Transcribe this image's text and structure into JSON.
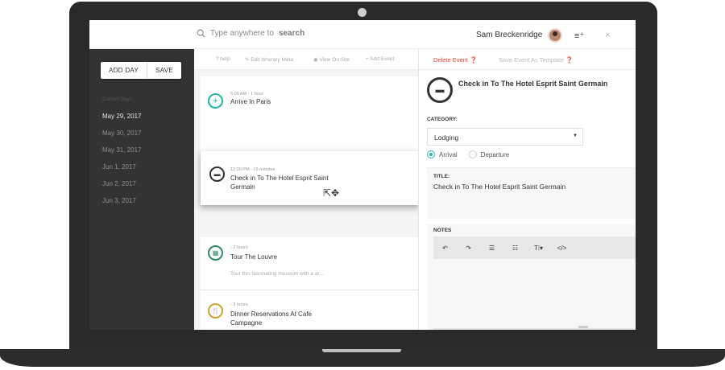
{
  "search": {
    "placeholder_prefix": "Type anywhere to",
    "placeholder_strong": "search"
  },
  "user": {
    "name": "Sam Breckenridge"
  },
  "sidebar": {
    "add_day_label": "ADD DAY",
    "save_label": "SAVE",
    "caption": "Content Days",
    "days": [
      "May 29, 2017",
      "May 30, 2017",
      "May 31, 2017",
      "Jun 1, 2017",
      "Jun 2, 2017",
      "Jun 3, 2017"
    ]
  },
  "toolbar": {
    "help": "? help",
    "edit_meta": "Edit Itinerary Meta",
    "view_on_site": "View On Site",
    "add_event": "+ Add Event"
  },
  "events": [
    {
      "meta": "5:00 AM - 1 hour",
      "title": "Arrive In Paris",
      "desc": "",
      "icon": "plane-icon",
      "color": "#21b6a8"
    },
    {
      "meta": "12:00 PM - 15 minutes",
      "title": "Check in To The Hotel Esprit Saint Germain",
      "desc": "",
      "icon": "bed-icon",
      "color": "#333333"
    },
    {
      "meta": "- 2 hours",
      "title": "Tour The Louvre",
      "desc": "Tour this fascinating museum with a ar...",
      "icon": "calendar-icon",
      "color": "#2e8a6a"
    },
    {
      "meta": "- 3 hours",
      "title": "Dinner Reservations At Cafe Campagne",
      "desc": "",
      "icon": "restaurant-icon",
      "color": "#c9a42c"
    }
  ],
  "panel": {
    "delete_label": "Delete Event",
    "save_template_label": "Save Event As Template",
    "title": "Check in To The Hotel Esprit Saint Germain",
    "category_label": "CATEGORY:",
    "category_value": "Lodging",
    "radio_arrival": "Arrival",
    "radio_departure": "Departure",
    "title_label": "TITLE:",
    "title_value": "Check in To The Hotel Esprit Saint Germain",
    "notes_label": "NOTES"
  },
  "colors": {
    "accent": "#21b6a8",
    "danger": "#e0453a",
    "sidebar": "#333333"
  }
}
